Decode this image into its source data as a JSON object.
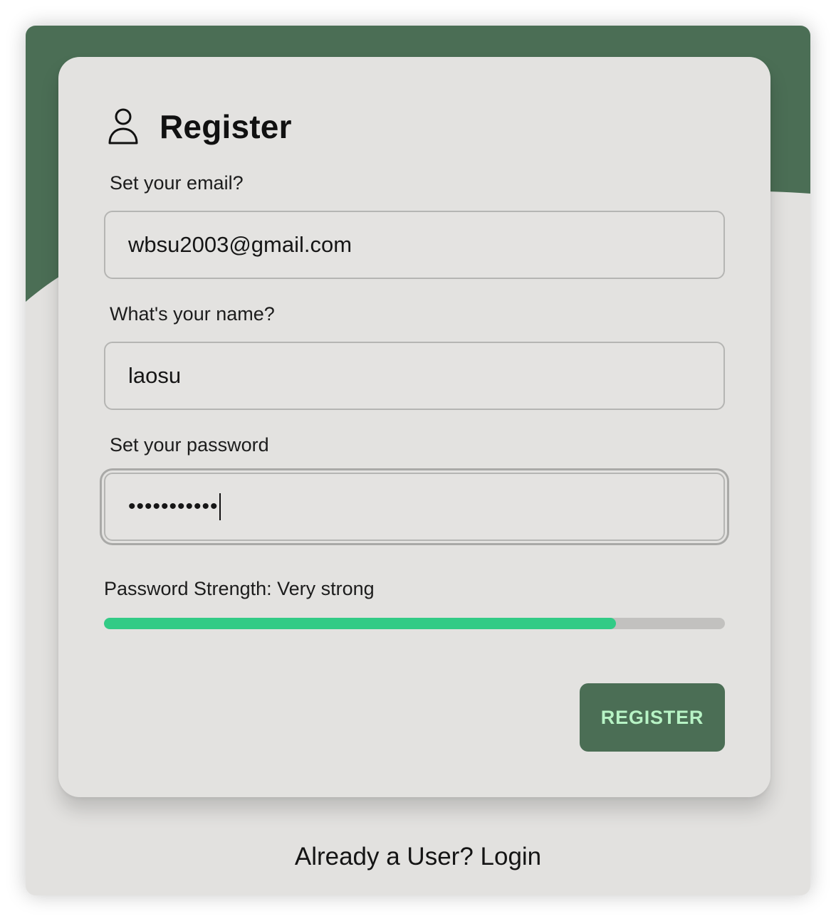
{
  "colors": {
    "accent_green": "#4b6e55",
    "strength_green": "#32cb86",
    "button_text": "#b7f3c5",
    "card_background": "#e3e2e0"
  },
  "header": {
    "icon": "user-icon",
    "title": "Register"
  },
  "form": {
    "email": {
      "label": "Set your email?",
      "value": "wbsu2003@gmail.com"
    },
    "name": {
      "label": "What's your name?",
      "value": "laosu"
    },
    "password": {
      "label": "Set your password",
      "masked_value": "•••••••••••",
      "focused": true
    }
  },
  "strength": {
    "label": "Password Strength: Very strong",
    "level": 0.825
  },
  "actions": {
    "register_label": "REGISTER"
  },
  "footer": {
    "login_text": "Already a User? Login"
  }
}
